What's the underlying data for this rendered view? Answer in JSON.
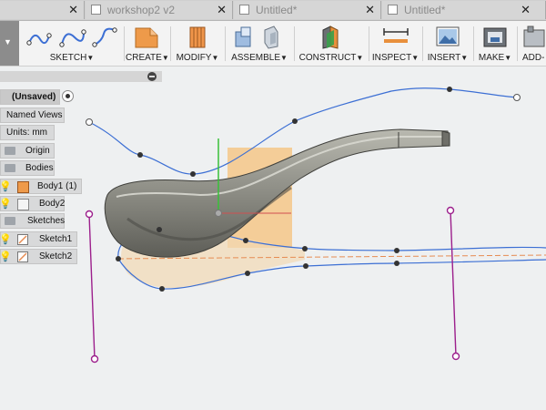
{
  "tabs": [
    {
      "label": "",
      "closable": true
    },
    {
      "label": "workshop2 v2",
      "closable": true
    },
    {
      "label": "Untitled*",
      "closable": true
    },
    {
      "label": "Untitled*",
      "closable": true
    }
  ],
  "toolbar": {
    "groups": [
      {
        "label": "SKETCH",
        "icon": "sketch-spline-icons"
      },
      {
        "label": "CREATE",
        "icon": "create-box-icon"
      },
      {
        "label": "MODIFY",
        "icon": "modify-press-pull-icon"
      },
      {
        "label": "ASSEMBLE",
        "icon": "assemble-component-icon"
      },
      {
        "label": "CONSTRUCT",
        "icon": "construct-plane-icon"
      },
      {
        "label": "INSPECT",
        "icon": "inspect-measure-icon"
      },
      {
        "label": "INSERT",
        "icon": "insert-image-icon"
      },
      {
        "label": "MAKE",
        "icon": "make-3d-print-icon"
      },
      {
        "label": "ADD-",
        "icon": "add-ins-icon"
      }
    ]
  },
  "browser": {
    "root": "(Unsaved)",
    "items": {
      "named_views": "Named Views",
      "units": "Units: mm",
      "origin": "Origin",
      "bodies": "Bodies",
      "body1": "Body1 (1)",
      "body2": "Body2",
      "sketches": "Sketches",
      "sketch1": "Sketch1",
      "sketch2": "Sketch2"
    }
  },
  "colors": {
    "curve": "#3c6fd4",
    "construction": "#9c1f8c",
    "offset_line": "#e68b52",
    "body": "#8a8a82",
    "origin_plane": "#f5c27a"
  }
}
